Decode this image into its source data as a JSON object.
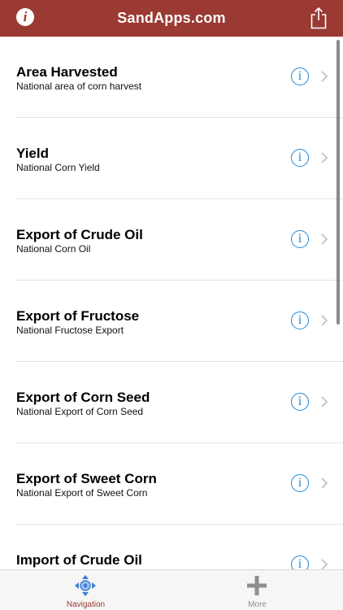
{
  "header": {
    "title": "SandApps.com",
    "info_icon": "info-icon",
    "share_icon": "share-icon",
    "background_color": "#9a3a32"
  },
  "list": {
    "items": [
      {
        "title": "Area Harvested",
        "subtitle": "National area of corn harvest"
      },
      {
        "title": "Yield",
        "subtitle": "National Corn Yield"
      },
      {
        "title": "Export of Crude Oil",
        "subtitle": "National Corn Oil"
      },
      {
        "title": "Export of Fructose",
        "subtitle": "National Fructose Export"
      },
      {
        "title": "Export of Corn Seed",
        "subtitle": "National Export of Corn Seed"
      },
      {
        "title": "Export of Sweet Corn",
        "subtitle": "National Export of Sweet Corn"
      },
      {
        "title": "Import of Crude Oil",
        "subtitle": ""
      }
    ],
    "info_glyph": "i",
    "accent_color": "#1e88d9"
  },
  "tabbar": {
    "tabs": [
      {
        "label": "Navigation",
        "icon": "navigation-icon",
        "selected": true
      },
      {
        "label": "More",
        "icon": "plus-icon",
        "selected": false
      }
    ]
  }
}
